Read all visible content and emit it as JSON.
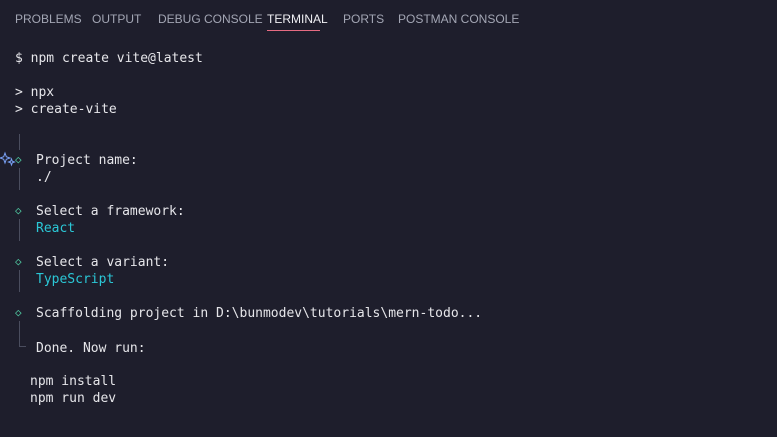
{
  "tabs": [
    {
      "label": "PROBLEMS"
    },
    {
      "label": "OUTPUT"
    },
    {
      "label": "DEBUG CONSOLE"
    },
    {
      "label": "TERMINAL"
    },
    {
      "label": "PORTS"
    },
    {
      "label": "POSTMAN CONSOLE"
    }
  ],
  "active_tab": "TERMINAL",
  "colors": {
    "background": "#1e1e2c",
    "accent_text": "#2bc7d6",
    "diamond": "#4fc7a0",
    "active_tab_underline": "#e66b82"
  },
  "terminal": {
    "command": "$ npm create vite@latest",
    "npx_line1": "> npx",
    "npx_line2": "> create-vite",
    "project_name_label": "Project name:",
    "project_name_value": "./",
    "framework_label": "Select a framework:",
    "framework_value": "React",
    "variant_label": "Select a variant:",
    "variant_value": "TypeScript",
    "scaffolding": "Scaffolding project in D:\\bunmodev\\tutorials\\mern-todo...",
    "done": "Done. Now run:",
    "next1": "npm install",
    "next2": "npm run dev"
  },
  "icons": {
    "gutter": "sparkle-icon",
    "step": "diamond-icon"
  }
}
